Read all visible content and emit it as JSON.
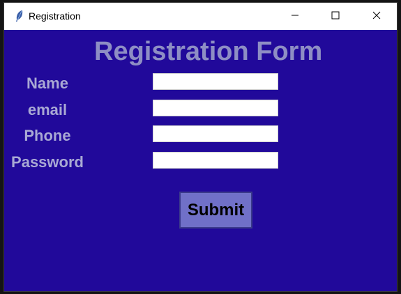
{
  "window": {
    "title": "Registration",
    "controls": {
      "minimize_icon": "minimize-icon",
      "maximize_icon": "maximize-icon",
      "close_icon": "close-icon"
    },
    "app_icon": "feather-icon"
  },
  "form": {
    "title": "Registration Form",
    "fields": [
      {
        "label": "Name",
        "value": ""
      },
      {
        "label": "email",
        "value": ""
      },
      {
        "label": "Phone",
        "value": ""
      },
      {
        "label": "Password",
        "value": ""
      }
    ],
    "submit_label": "Submit"
  },
  "colors": {
    "background": "#21099a",
    "title_text": "#8e8ec4",
    "label_text": "#a9a9d4",
    "button_bg": "#7070c8"
  }
}
